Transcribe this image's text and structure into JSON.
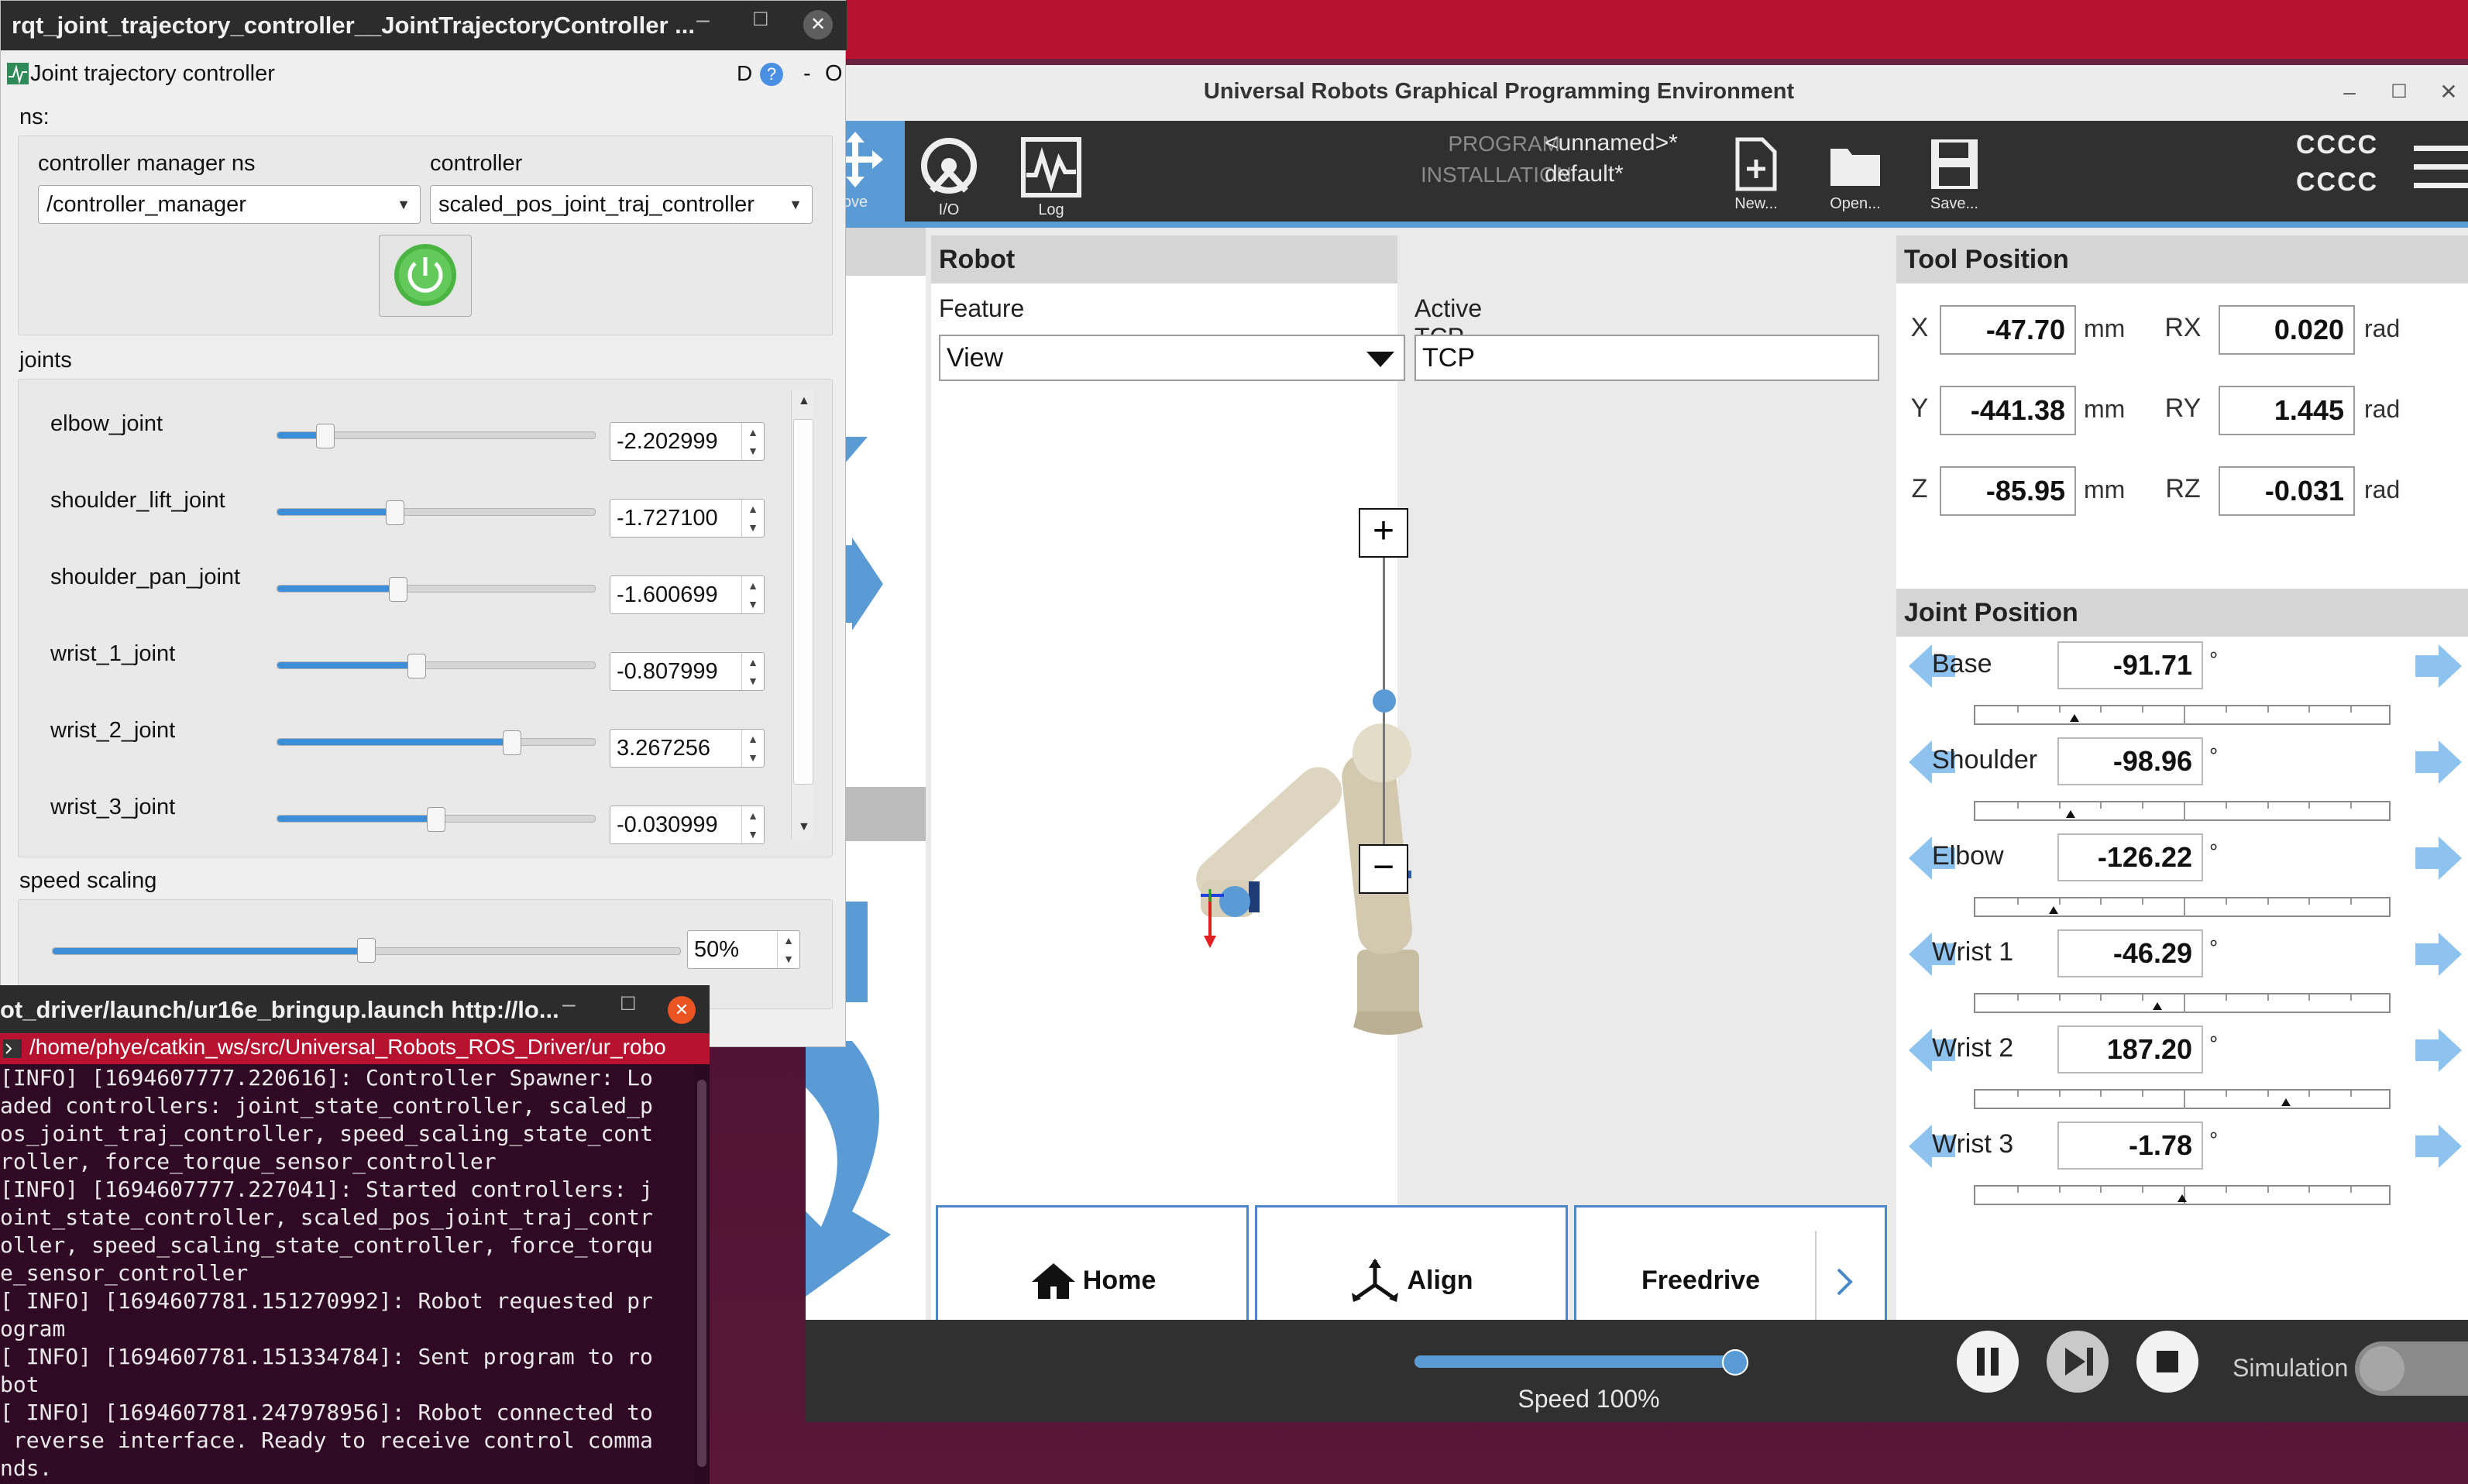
{
  "rqt": {
    "title": "rqt_joint_trajectory_controller__JointTrajectoryController ...",
    "plugin_title": "Joint trajectory controller",
    "plugin_buttons": [
      "D",
      "?",
      "-",
      "O"
    ],
    "ns_label": "ns:",
    "cm_ns_label": "controller manager ns",
    "cm_ns_value": "/controller_manager",
    "controller_label": "controller",
    "controller_value": "scaled_pos_joint_traj_controller",
    "joints_label": "joints",
    "joints": [
      {
        "name": "elbow_joint",
        "value": "-2.202999",
        "level": 0.15
      },
      {
        "name": "shoulder_lift_joint",
        "value": "-1.727100",
        "level": 0.37
      },
      {
        "name": "shoulder_pan_joint",
        "value": "-1.600699",
        "level": 0.38
      },
      {
        "name": "wrist_1_joint",
        "value": "-0.807999",
        "level": 0.44
      },
      {
        "name": "wrist_2_joint",
        "value": "3.267256",
        "level": 0.74
      },
      {
        "name": "wrist_3_joint",
        "value": "-0.030999",
        "level": 0.5
      }
    ],
    "speed_label": "speed scaling",
    "speed_value": "50%",
    "speed_level": 0.5
  },
  "terminal": {
    "title": "ot_driver/launch/ur16e_bringup.launch http://lo...",
    "tab": "/home/phye/catkin_ws/src/Universal_Robots_ROS_Driver/ur_robo",
    "lines": [
      "[INFO] [1694607777.220616]: Controller Spawner: Lo",
      "aded controllers: joint_state_controller, scaled_p",
      "os_joint_traj_controller, speed_scaling_state_cont",
      "roller, force_torque_sensor_controller",
      "[INFO] [1694607777.227041]: Started controllers: j",
      "oint_state_controller, scaled_pos_joint_traj_contr",
      "oller, speed_scaling_state_controller, force_torqu",
      "e_sensor_controller",
      "[ INFO] [1694607781.151270992]: Robot requested pr",
      "ogram",
      "[ INFO] [1694607781.151334784]: Sent program to ro",
      "bot",
      "[ INFO] [1694607781.247978956]: Robot connected to",
      " reverse interface. Ready to receive control comma",
      "nds."
    ]
  },
  "ur": {
    "title": "Universal Robots Graphical Programming Environment",
    "toolbar": {
      "move_label": "ove",
      "io_label": "I/O",
      "log_label": "Log",
      "program_label": "PROGRAM",
      "program_value": "<unnamed>*",
      "installation_label": "INSTALLATION",
      "installation_value": "default*",
      "new_label": "New...",
      "open_label": "Open...",
      "save_label": "Save...",
      "status_line1": "CCCC",
      "status_line2": "CCCC"
    },
    "robot": {
      "header": "Robot",
      "feature_label": "Feature",
      "feature_value": "View",
      "tcp_label": "Active TCP",
      "tcp_value": "TCP",
      "zoom_plus": "+",
      "zoom_minus": "−",
      "zoom_level": 0.5,
      "home_label": "Home",
      "align_label": "Align",
      "freedrive_label": "Freedrive"
    },
    "tool_position": {
      "header": "Tool Position",
      "rows": [
        {
          "axis": "X",
          "value": "-47.70",
          "unit": "mm",
          "raxis": "RX",
          "rvalue": "0.020",
          "runit": "rad"
        },
        {
          "axis": "Y",
          "value": "-441.38",
          "unit": "mm",
          "raxis": "RY",
          "rvalue": "1.445",
          "runit": "rad"
        },
        {
          "axis": "Z",
          "value": "-85.95",
          "unit": "mm",
          "raxis": "RZ",
          "rvalue": "-0.031",
          "runit": "rad"
        }
      ]
    },
    "joint_position": {
      "header": "Joint Position",
      "degree_symbol": "°",
      "joints": [
        {
          "name": "Base",
          "value": "-91.71",
          "level": 0.24
        },
        {
          "name": "Shoulder",
          "value": "-98.96",
          "level": 0.23
        },
        {
          "name": "Elbow",
          "value": "-126.22",
          "level": 0.19
        },
        {
          "name": "Wrist 1",
          "value": "-46.29",
          "level": 0.44
        },
        {
          "name": "Wrist 2",
          "value": "187.20",
          "level": 0.75
        },
        {
          "name": "Wrist 3",
          "value": "-1.78",
          "level": 0.5
        }
      ]
    },
    "bottom": {
      "speed_label": "Speed 100%",
      "speed_level": 1.0,
      "simulation_label": "Simulation"
    },
    "colors": {
      "accent": "#5b9bd5",
      "toolbar": "#303030"
    }
  }
}
